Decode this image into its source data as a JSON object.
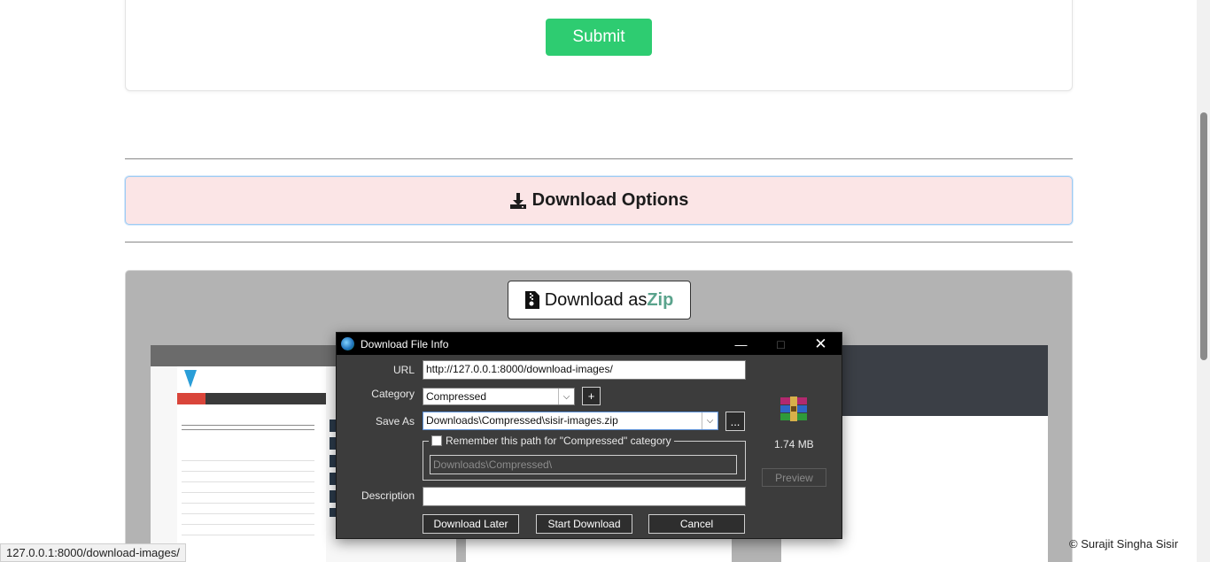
{
  "form": {
    "submit_label": "Submit"
  },
  "options": {
    "title": "Download Options",
    "icon": "download-icon"
  },
  "zip": {
    "label_prefix": "Download as ",
    "label_accent": "Zip",
    "icon": "file-zip-icon",
    "accent_color": "#5aa38c"
  },
  "dialog": {
    "title": "Download File Info",
    "url_label": "URL",
    "url_value": "http://127.0.0.1:8000/download-images/",
    "category_label": "Category",
    "category_value": "Compressed",
    "add_label": "+",
    "save_as_label": "Save As",
    "save_as_value": "Downloads\\Compressed\\sisir-images.zip",
    "browse_label": "...",
    "remember_label": "Remember this path for \"Compressed\" category",
    "remember_path": "Downloads\\Compressed\\",
    "description_label": "Description",
    "description_value": "",
    "file_size": "1.74  MB",
    "preview_label": "Preview",
    "download_later_label": "Download Later",
    "start_download_label": "Start Download",
    "cancel_label": "Cancel"
  },
  "status_bar": {
    "url": "127.0.0.1:8000/download-images/"
  },
  "footer": {
    "copyright": "© Surajit Singha Sisir"
  },
  "colors": {
    "submit": "#2ecc71",
    "options_bg": "#fbe5e6",
    "dialog_bg": "#3c3c3c"
  }
}
